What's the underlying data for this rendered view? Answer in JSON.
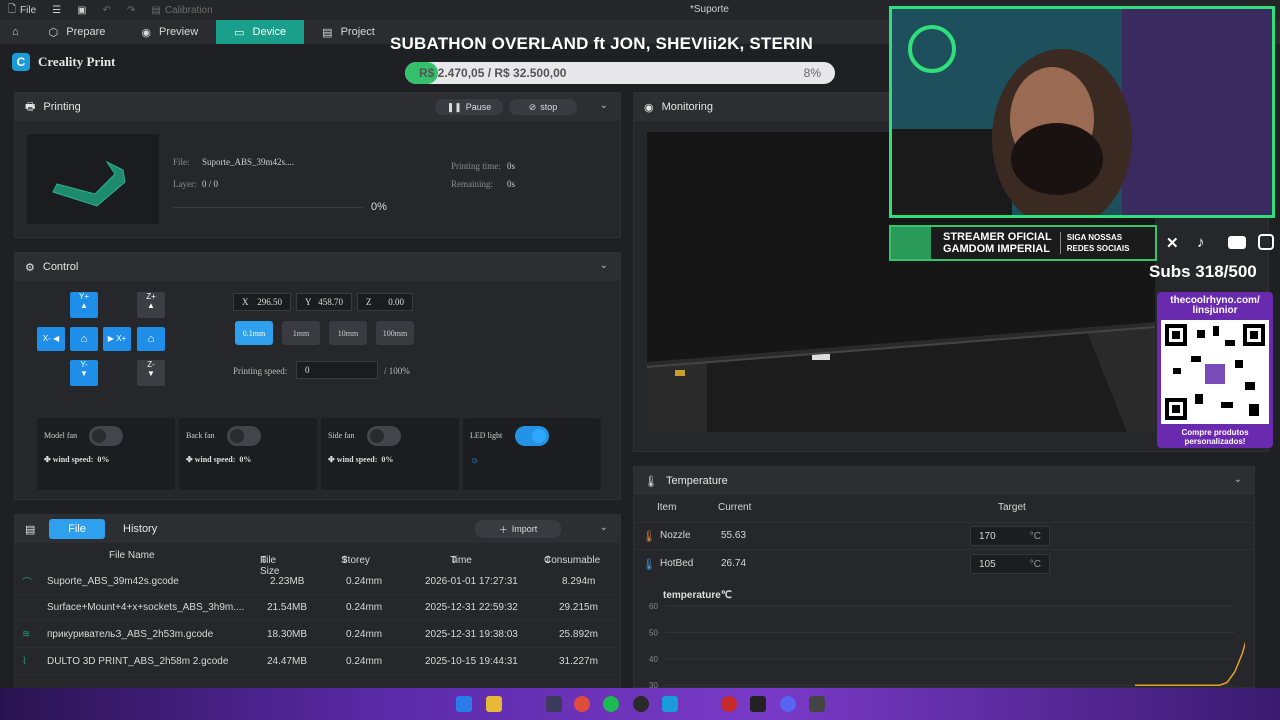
{
  "titlebar": {
    "file": "File",
    "calibration": "Calibration",
    "window_title": "*Suporte"
  },
  "nav": {
    "tabs": [
      {
        "label": "Prepare",
        "icon": "cube-icon"
      },
      {
        "label": "Preview",
        "icon": "eye-icon"
      },
      {
        "label": "Device",
        "icon": "device-icon"
      },
      {
        "label": "Project",
        "icon": "document-icon"
      }
    ],
    "active": "Device"
  },
  "brand": {
    "name": "Creality Print",
    "logo": "C"
  },
  "printing": {
    "title": "Printing",
    "pause": "Pause",
    "stop": "stop",
    "file_label": "File:",
    "file_value": "Suporte_ABS_39m42s....",
    "layer_label": "Layer:",
    "layer_value": "0 / 0",
    "progress": "0%",
    "printing_time_label": "Printing time:",
    "printing_time_value": "0s",
    "remaining_label": "Remaining:",
    "remaining_value": "0s"
  },
  "control": {
    "title": "Control",
    "jog": {
      "yplus": "Y+",
      "yminus": "Y-",
      "xminus": "X-",
      "xplus": "X+",
      "zplus": "Z+",
      "zminus": "Z-"
    },
    "coords": {
      "x_label": "X",
      "x": "296.50",
      "y_label": "Y",
      "y": "458.70",
      "z_label": "Z",
      "z": "0.00"
    },
    "steps": [
      "0.1mm",
      "1mm",
      "10mm",
      "100mm"
    ],
    "active_step": "0.1mm",
    "speed_label": "Printing speed:",
    "speed_value": "0",
    "speed_suffix": "/ 100%",
    "fans": [
      {
        "name": "Model fan",
        "on": false,
        "wind_label": "wind speed:",
        "wind_value": "0%"
      },
      {
        "name": "Back fan",
        "on": false,
        "wind_label": "wind speed:",
        "wind_value": "0%"
      },
      {
        "name": "Side fan",
        "on": false,
        "wind_label": "wind speed:",
        "wind_value": "0%"
      }
    ],
    "led": {
      "name": "LED light",
      "on": true
    }
  },
  "files": {
    "tabs": [
      "File",
      "History"
    ],
    "import": "Import",
    "headers": [
      "File Name",
      "File Size",
      "Storey",
      "Time",
      "Consumable"
    ],
    "rows": [
      {
        "name": "Suporte_ABS_39m42s.gcode",
        "size": "2.23MB",
        "storey": "0.24mm",
        "time": "2026-01-01 17:27:31",
        "consumable": "8.294m"
      },
      {
        "name": "Surface+Mount+4+x+sockets_ABS_3h9m....",
        "size": "21.54MB",
        "storey": "0.24mm",
        "time": "2025-12-31 22:59:32",
        "consumable": "29.215m"
      },
      {
        "name": "прикуривательЗ_ABS_2h53m.gcode",
        "size": "18.30MB",
        "storey": "0.24mm",
        "time": "2025-12-31 19:38:03",
        "consumable": "25.892m"
      },
      {
        "name": "DULTO 3D PRINT_ABS_2h58m 2.gcode",
        "size": "24.47MB",
        "storey": "0.24mm",
        "time": "2025-10-15 19:44:31",
        "consumable": "31.227m"
      }
    ]
  },
  "monitoring": {
    "title": "Monitoring"
  },
  "temperature": {
    "title": "Temperature",
    "headers": [
      "Item",
      "Current",
      "Target"
    ],
    "rows": [
      {
        "item": "Nozzle",
        "current": "55.63",
        "target": "170",
        "unit": "°C"
      },
      {
        "item": "HotBed",
        "current": "26.74",
        "target": "105",
        "unit": "°C"
      }
    ],
    "chart_title": "temperature℃"
  },
  "chart_data": {
    "type": "line",
    "title": "temperature℃",
    "ylim": [
      30,
      60
    ],
    "y_ticks": [
      "60",
      "50",
      "40",
      "30"
    ],
    "series": [
      {
        "values": [
          30,
          30,
          30,
          30,
          30,
          30,
          30,
          30,
          30,
          30,
          30,
          30,
          31,
          35,
          42,
          52
        ]
      }
    ],
    "grid": true
  },
  "overlay": {
    "title": "SUBATHON OVERLAND ft JON, SHEVIii2K, STERIN",
    "goal_text": "R$ 2.470,05 / R$ 32.500,00",
    "goal_pct": "8%",
    "goal_fraction": 0.076,
    "banner_line1": "STREAMER OFICIAL",
    "banner_line2": "GAMDOM IMPERIAL",
    "banner_line3": "SIGA NOSSAS",
    "banner_line4": "REDES SOCIAIS",
    "subs": "Subs 318/500",
    "shop_line1": "thecoolrhyno.com/",
    "shop_line2": "linsjunior",
    "shop_line3": "Compre produtos",
    "shop_line4": "personalizados!"
  },
  "colors": {
    "accent": "#1aa08a",
    "blue": "#2493e6",
    "green": "#35c06b"
  }
}
